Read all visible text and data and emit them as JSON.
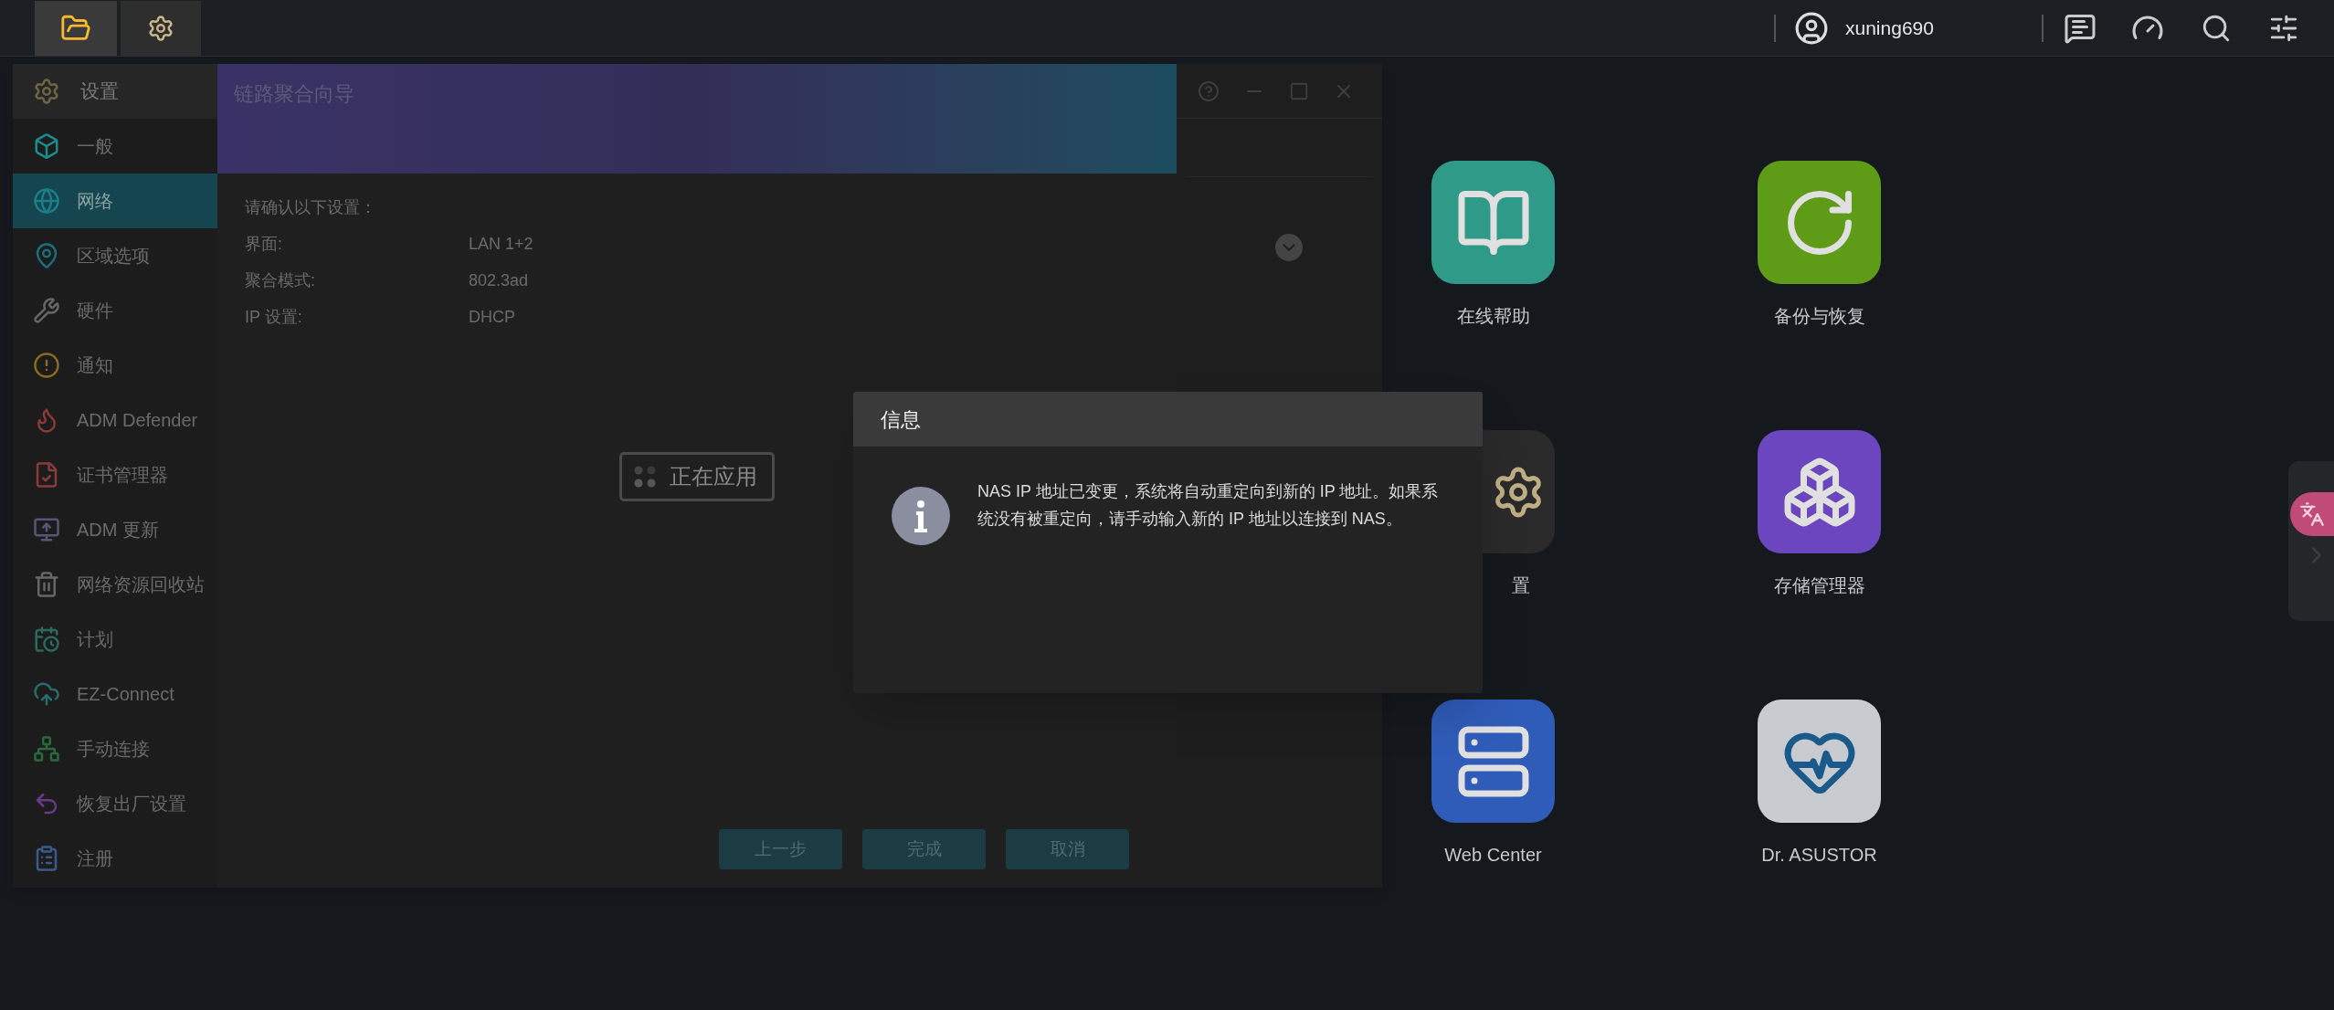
{
  "top_bar": {
    "user": "xuning690"
  },
  "settings_window": {
    "title": "设置",
    "sidebar": [
      {
        "label": "一般",
        "selected": false
      },
      {
        "label": "网络",
        "selected": true
      },
      {
        "label": "区域选项",
        "selected": false
      },
      {
        "label": "硬件",
        "selected": false
      },
      {
        "label": "通知",
        "selected": false
      },
      {
        "label": "ADM Defender",
        "selected": false
      },
      {
        "label": "证书管理器",
        "selected": false
      },
      {
        "label": "ADM 更新",
        "selected": false
      },
      {
        "label": "网络资源回收站",
        "selected": false
      },
      {
        "label": "计划",
        "selected": false
      },
      {
        "label": "EZ-Connect",
        "selected": false
      },
      {
        "label": "手动连接",
        "selected": false
      },
      {
        "label": "恢复出厂设置",
        "selected": false
      },
      {
        "label": "注册",
        "selected": false
      }
    ]
  },
  "wizard": {
    "title": "链路聚合向导",
    "prompt": "请确认以下设置：",
    "fields": [
      {
        "label": "界面:",
        "value": "LAN 1+2"
      },
      {
        "label": "聚合模式:",
        "value": "802.3ad"
      },
      {
        "label": "IP 设置:",
        "value": "DHCP"
      }
    ],
    "status": "正在应用",
    "buttons": [
      "上一步",
      "完成",
      "取消"
    ]
  },
  "dialog": {
    "title": "信息",
    "message": "NAS IP 地址已变更，系统将自动重定向到新的 IP 地址。如果系统没有被重定向，请手动输入新的 IP 地址以连接到 NAS。"
  },
  "desktop": [
    {
      "label": "在线帮助"
    },
    {
      "label": "备份与恢复"
    },
    {
      "label": "置"
    },
    {
      "label": "存储管理器"
    },
    {
      "label": "Web Center"
    },
    {
      "label": "Dr. ASUSTOR"
    }
  ]
}
